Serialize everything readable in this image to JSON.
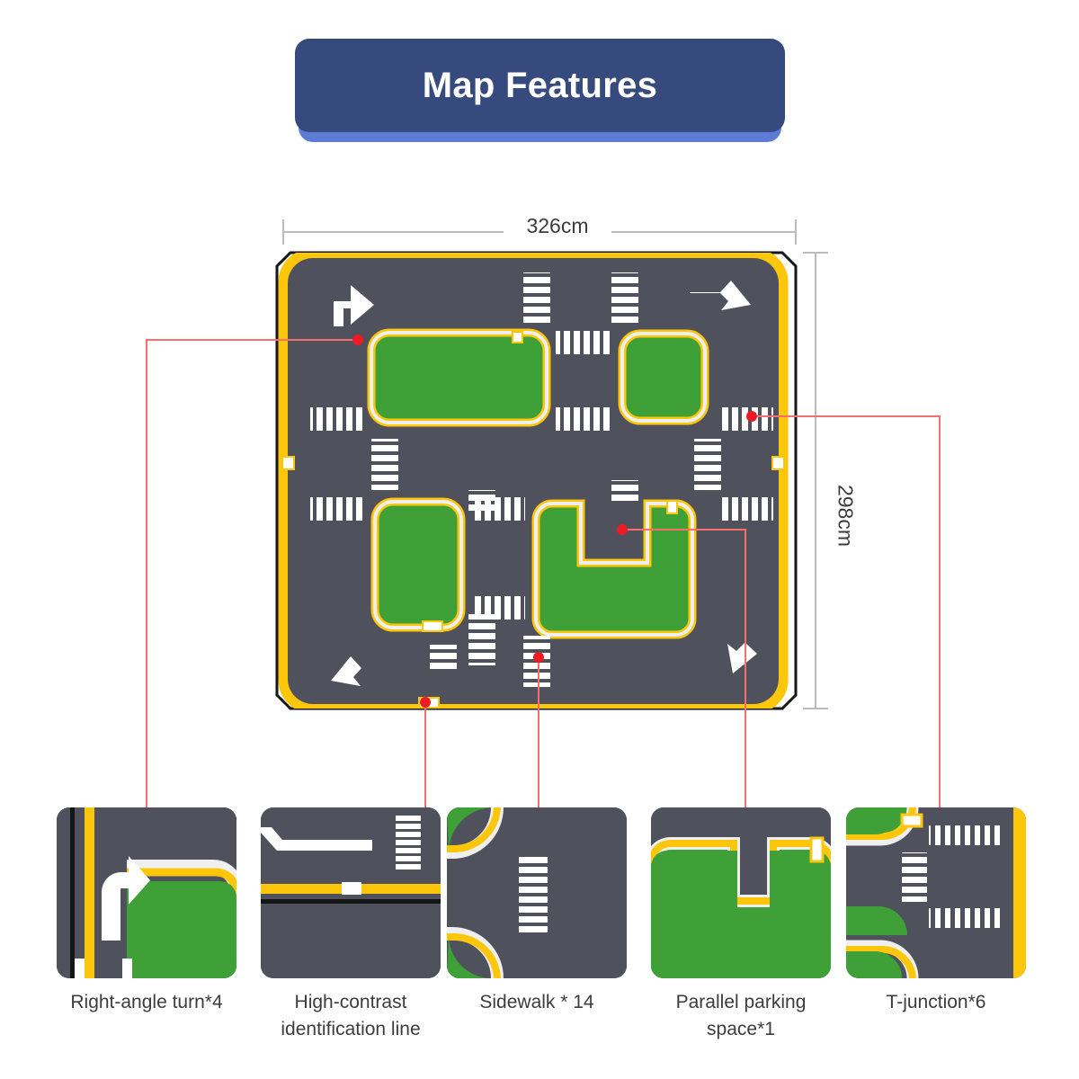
{
  "banner": {
    "title": "Map Features"
  },
  "dimensions": {
    "width_label": "326cm",
    "height_label": "298cm"
  },
  "colors": {
    "banner_blue": "#374a7d",
    "banner_shadow_blue": "#5b7bd5",
    "road_gray": "#4f525c",
    "grass_green": "#3ea037",
    "lane_yellow": "#fcc60b",
    "marking_white": "#ffffff",
    "connector_red": "#f4706e",
    "dot_red": "#ed1c24",
    "dimension_gray": "#bcbcbc",
    "text_gray": "#3c3c3c",
    "outline_black": "#161616"
  },
  "map": {
    "name": "road-play-mat",
    "islands": [
      {
        "name": "island-top-left",
        "shape": "rounded-rect"
      },
      {
        "name": "island-top-right",
        "shape": "rounded-square"
      },
      {
        "name": "island-bottom-left",
        "shape": "rounded-rect"
      },
      {
        "name": "island-parking-u",
        "shape": "u-shape"
      }
    ],
    "arrows": [
      {
        "name": "arrow-turn-up-right",
        "position": "top-left"
      },
      {
        "name": "arrow-turn-right-down",
        "position": "top-right"
      },
      {
        "name": "arrow-turn-left-up",
        "position": "bottom-left"
      },
      {
        "name": "arrow-turn-down-left",
        "position": "bottom-right"
      }
    ],
    "hotspots": [
      {
        "name": "hotspot-right-angle-turn",
        "target": "card-right-angle-turn"
      },
      {
        "name": "hotspot-high-contrast-line",
        "target": "card-high-contrast-line"
      },
      {
        "name": "hotspot-sidewalk",
        "target": "card-sidewalk"
      },
      {
        "name": "hotspot-parallel-parking",
        "target": "card-parallel-parking"
      },
      {
        "name": "hotspot-t-junction",
        "target": "card-t-junction"
      }
    ]
  },
  "features": [
    {
      "id": "card-right-angle-turn",
      "label": "Right-angle turn*4"
    },
    {
      "id": "card-high-contrast-line",
      "label": "High-contrast\nidentification line",
      "line1": "High-contrast",
      "line2": "identification line"
    },
    {
      "id": "card-sidewalk",
      "label": "Sidewalk * 14"
    },
    {
      "id": "card-parallel-parking",
      "label": "Parallel parking\nspace*1",
      "line1": "Parallel parking",
      "line2": "space*1"
    },
    {
      "id": "card-t-junction",
      "label": "T-junction*6"
    }
  ],
  "feature_labels": {
    "f0": "Right-angle turn*4",
    "f1a": "High-contrast",
    "f1b": "identification line",
    "f2": "Sidewalk * 14",
    "f3a": "Parallel parking",
    "f3b": "space*1",
    "f4": "T-junction*6"
  }
}
